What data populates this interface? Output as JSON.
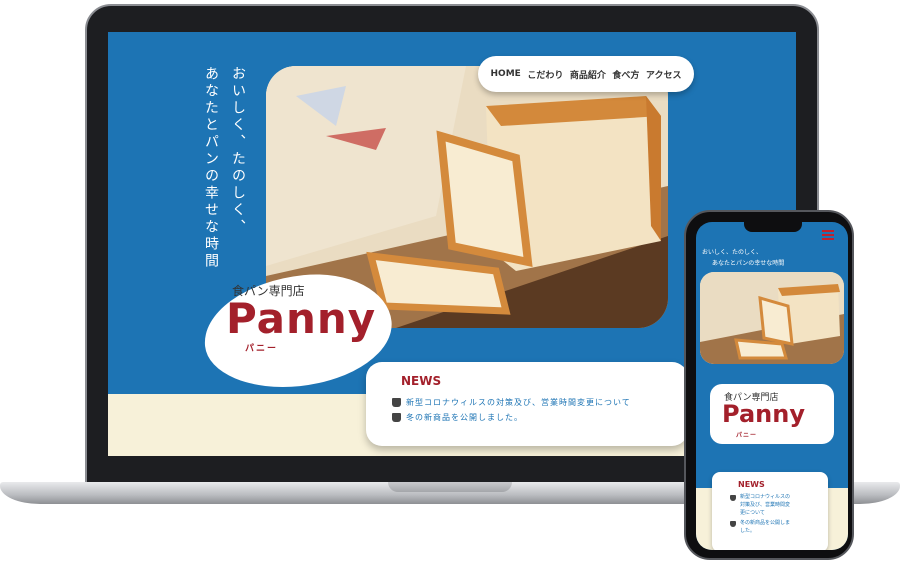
{
  "site": {
    "tagline_lines": [
      "おいしく、たのしく、",
      "あなたとパンの幸せな時間"
    ],
    "nav": [
      "HOME",
      "こだわり",
      "商品紹介",
      "食べ方",
      "アクセス"
    ],
    "logo": {
      "subtitle": "食パン専門店",
      "name": "Panny",
      "kana": "パニー"
    },
    "news": {
      "title": "NEWS",
      "items": [
        "新型コロナウィルスの対策及び、営業時間変更について",
        "冬の新商品を公開しました。"
      ]
    }
  },
  "mobile": {
    "tagline_lines": [
      "おいしく、たのしく、",
      "あなたとパンの幸せな時間"
    ],
    "logo": {
      "subtitle": "食パン専門店",
      "name": "Panny",
      "kana": "パニー"
    },
    "news": {
      "title": "NEWS",
      "items": [
        "新型コロナウィルスの\n対策及び、営業時間変\n更について",
        "冬の新商品を公開しま\nした。"
      ]
    },
    "menu_icon": "hamburger-icon"
  },
  "colors": {
    "primary_blue": "#1d74b4",
    "brand_red": "#a3202b",
    "cream": "#f7f1d9"
  }
}
